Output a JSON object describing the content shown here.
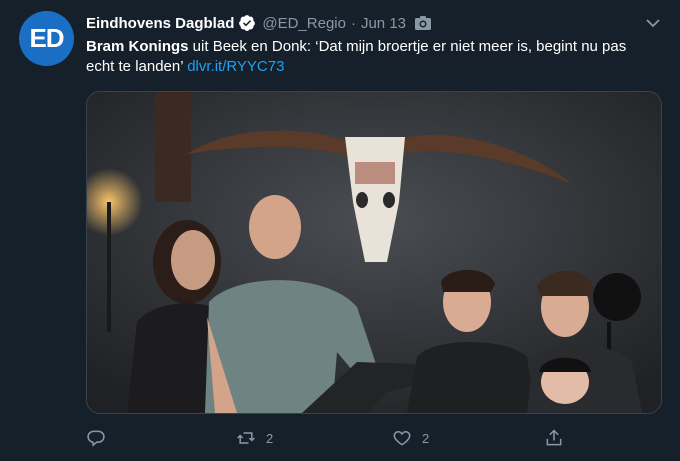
{
  "tweet": {
    "avatar_text": "ED",
    "author_name": "Eindhovens Dagblad",
    "handle": "@ED_Regio",
    "separator": "·",
    "date": "Jun 13",
    "text_bold": "Bram Konings",
    "text_body": " uit Beek en Donk: ‘Dat mijn broertje er niet meer is, begint nu pas echt te landen’ ",
    "link": "dlvr.it/RYYC73",
    "media_description_icon": "photo-icon",
    "actions": {
      "reply_count": "",
      "retweet_count": "2",
      "like_count": "2"
    }
  },
  "colors": {
    "background": "#15202b",
    "accent": "#1da1f2",
    "secondary_text": "#8899a6",
    "avatar": "#1a6fc4"
  }
}
